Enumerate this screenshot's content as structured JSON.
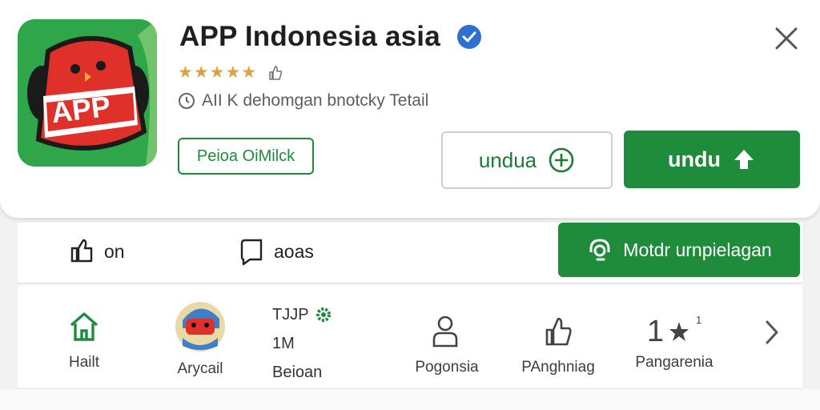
{
  "app": {
    "title": "APP Indonesia asia",
    "stars": "★★★★★",
    "info_text": "AII K dehomgan bnotcky Tetail",
    "icon_text": "APP",
    "developer_button": "Peioa OiMilck"
  },
  "buttons": {
    "outline_label": "undua",
    "primary_label": "undu"
  },
  "actions": {
    "item1": "on",
    "item2": "aoas",
    "feature_button": "Motdr urnpielagan"
  },
  "stats": {
    "home_label": "Hailt",
    "avatar_label": "Arycail",
    "dev_name": "TJJP",
    "dev_count": "1M",
    "dev_sub": "Beioan",
    "user_label": "Pogonsia",
    "like_label": "PAnghniag",
    "rating_value": "1",
    "rating_sup": "1",
    "rating_label": "Pangarenia"
  },
  "colors": {
    "brand_green": "#1e8c3a",
    "icon_bg_green": "#2fa64a",
    "icon_red": "#e0302a",
    "star_gold": "#d9a441",
    "verified_blue": "#2f6fd1"
  },
  "icons": [
    "verified-badge-icon",
    "close-icon",
    "thumbs-up-icon",
    "clock-icon",
    "plus-circle-icon",
    "upload-arrow-icon",
    "share-icon",
    "bookmark-icon",
    "headset-icon",
    "home-icon",
    "gear-badge-icon",
    "person-icon",
    "like-icon",
    "star-icon",
    "chevron-right-icon"
  ]
}
